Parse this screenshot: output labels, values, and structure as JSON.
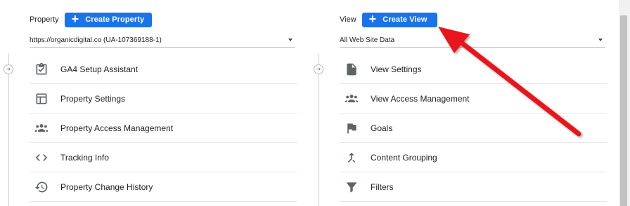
{
  "property": {
    "label": "Property",
    "create_label": "Create Property",
    "selected": "https://organicdigital.co (UA-107369188-1)",
    "items": [
      {
        "label": "GA4 Setup Assistant",
        "icon": "clipboard-check-icon"
      },
      {
        "label": "Property Settings",
        "icon": "layout-icon"
      },
      {
        "label": "Property Access Management",
        "icon": "people-icon"
      },
      {
        "label": "Tracking Info",
        "icon": "code-brackets-icon"
      },
      {
        "label": "Property Change History",
        "icon": "history-icon"
      }
    ]
  },
  "view": {
    "label": "View",
    "create_label": "Create View",
    "selected": "All Web Site Data",
    "items": [
      {
        "label": "View Settings",
        "icon": "document-icon"
      },
      {
        "label": "View Access Management",
        "icon": "people-icon"
      },
      {
        "label": "Goals",
        "icon": "flag-icon"
      },
      {
        "label": "Content Grouping",
        "icon": "merge-icon"
      },
      {
        "label": "Filters",
        "icon": "filter-icon"
      }
    ]
  },
  "colors": {
    "accent": "#1a73e8",
    "annotation_arrow": "#e8141c",
    "icon": "#5f6368"
  }
}
